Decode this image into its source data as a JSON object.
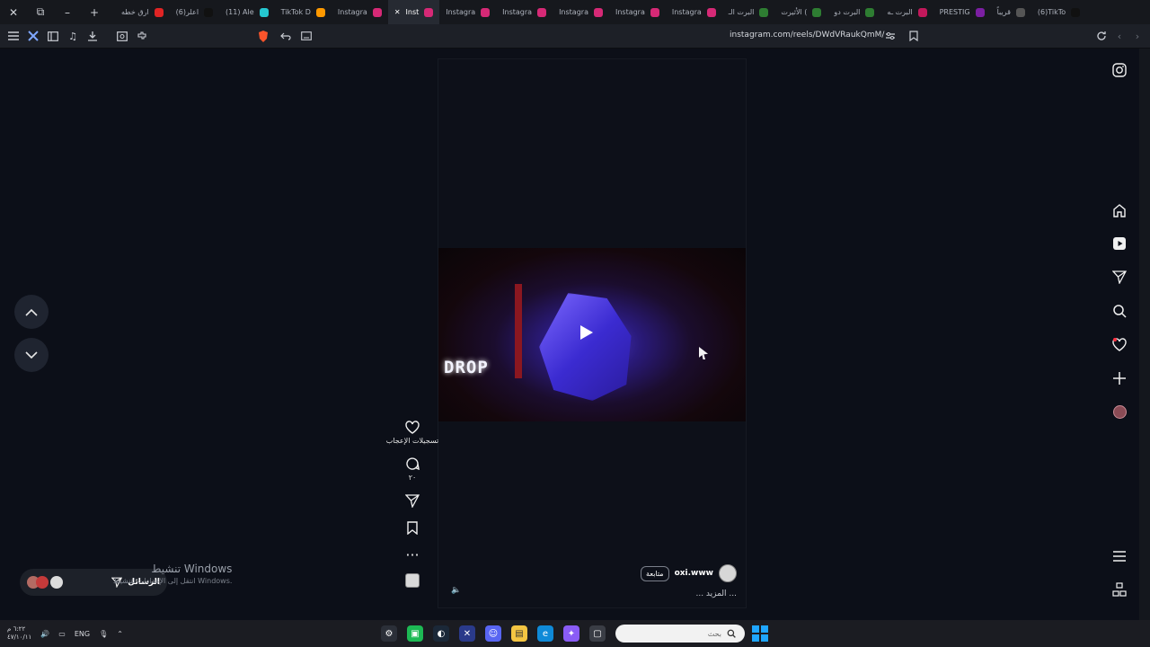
{
  "browser": {
    "window_controls": {
      "close": "✕",
      "restore": "⧉",
      "minimize": "–",
      "new_tab": "+"
    },
    "tabs": [
      {
        "label": "ارق خطه",
        "color": "#e02424"
      },
      {
        "label": "(6)اعلر",
        "color": "#111111"
      },
      {
        "label": "(11) Ale",
        "color": "#25c7d0"
      },
      {
        "label": "TikTok D",
        "color": "#ff9900"
      },
      {
        "label": "Instagra",
        "color": "#d62976"
      },
      {
        "label": "Inst",
        "color": "#d62976",
        "active": true
      },
      {
        "label": "Instagra",
        "color": "#d62976"
      },
      {
        "label": "Instagra",
        "color": "#d62976"
      },
      {
        "label": "Instagra",
        "color": "#d62976"
      },
      {
        "label": "Instagra",
        "color": "#d62976"
      },
      {
        "label": "Instagra",
        "color": "#d62976"
      },
      {
        "label": "البرت الـ",
        "color": "#2e7d32"
      },
      {
        "label": "الأثيرت (",
        "color": "#2e7d32"
      },
      {
        "label": "البرت دو",
        "color": "#2e7d32"
      },
      {
        "label": "البرت ـه",
        "color": "#c2185b"
      },
      {
        "label": "PRESTIG",
        "color": "#7b1fa2"
      },
      {
        "label": "قريباً",
        "color": "#555555"
      },
      {
        "label": "(6)TikTo",
        "color": "#111111"
      }
    ],
    "url": "instagram.com/reels/DWdVRaukQmM/"
  },
  "reel": {
    "overlay_text": "DROP",
    "username": "oxi.www",
    "follow_label": "متابعة",
    "caption_more": "... المزيد ...",
    "mute_icon": "🔈"
  },
  "actions": {
    "likes_label": "تسجيلات الإعجاب",
    "comments_count": "٢٠",
    "more_icon": "···"
  },
  "messages": {
    "label": "الرسائل"
  },
  "activate_windows": {
    "title": "تنشيط Windows",
    "subtitle": "انتقل إلى الإعدادات لتنشيط Windows."
  },
  "taskbar": {
    "clock_time": "٦:٢٢ م",
    "clock_date": "٤٧/١٠/١١",
    "lang": "ENG",
    "search_placeholder": "بحث"
  },
  "colors": {
    "accent": "#1fa6ff",
    "instagram": "#d62976",
    "like_dot": "#ff3040"
  }
}
